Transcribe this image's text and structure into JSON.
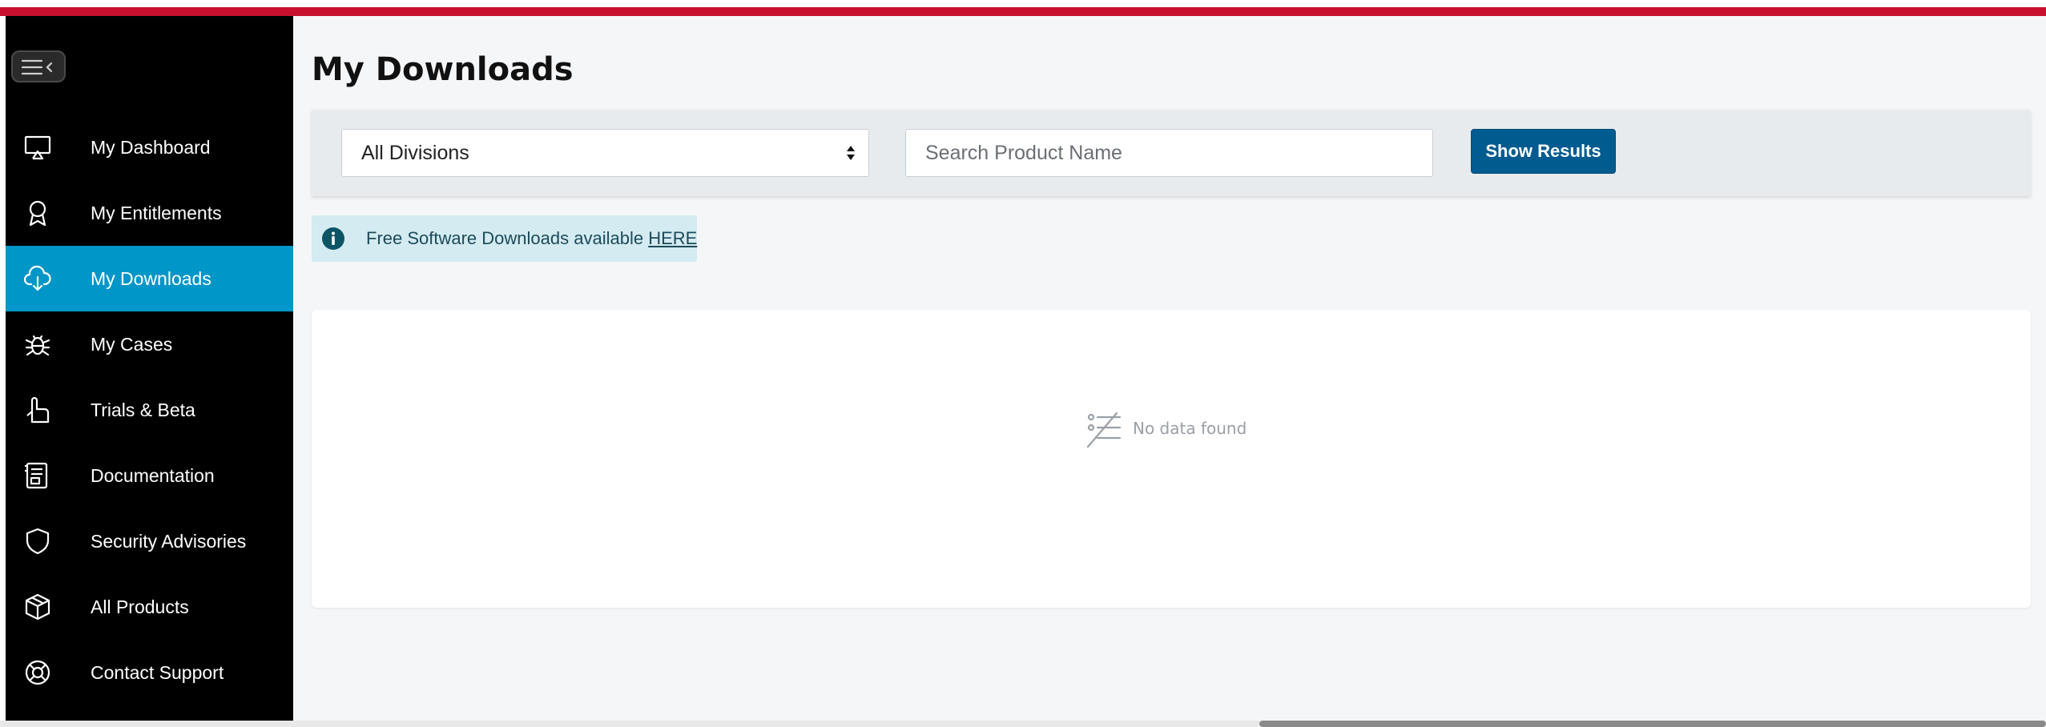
{
  "sidebar": {
    "collapse_icon": "menu-collapse-icon",
    "items": [
      {
        "label": "My Dashboard",
        "icon": "monitor-icon",
        "active": false
      },
      {
        "label": "My Entitlements",
        "icon": "award-ribbon-icon",
        "active": false
      },
      {
        "label": "My Downloads",
        "icon": "cloud-download-icon",
        "active": true
      },
      {
        "label": "My Cases",
        "icon": "bug-icon",
        "active": false
      },
      {
        "label": "Trials & Beta",
        "icon": "pointer-hand-icon",
        "active": false
      },
      {
        "label": "Documentation",
        "icon": "document-icon",
        "active": false
      },
      {
        "label": "Security Advisories",
        "icon": "shield-icon",
        "active": false
      },
      {
        "label": "All Products",
        "icon": "cube-box-icon",
        "active": false
      },
      {
        "label": "Contact Support",
        "icon": "lifebuoy-icon",
        "active": false
      }
    ]
  },
  "main": {
    "title": "My Downloads",
    "filters": {
      "division_selected": "All Divisions",
      "search_placeholder": "Search Product Name",
      "search_value": "",
      "show_button": "Show Results"
    },
    "info": {
      "text": "Free Software Downloads available ",
      "link": "HERE",
      "icon": "info-icon"
    },
    "empty_state": {
      "text": "No data found",
      "icon": "no-data-list-icon"
    }
  },
  "colors": {
    "accent_red": "#c8102e",
    "active_nav": "#0096c7",
    "primary_button": "#005b8f",
    "info_bg": "#d3ebf1"
  }
}
